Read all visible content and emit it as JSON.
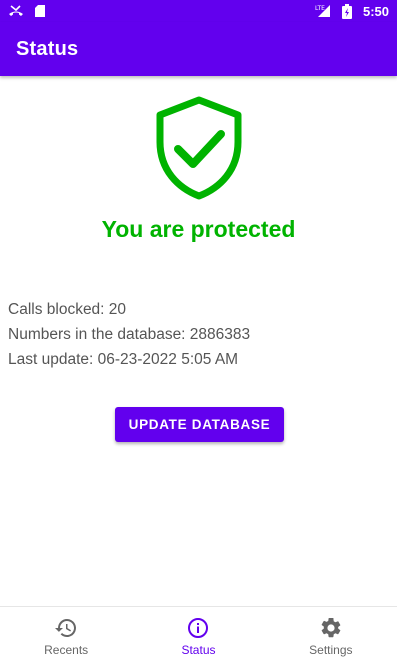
{
  "status_bar": {
    "time": "5:50",
    "network": "LTE",
    "icons": [
      "missed-call-icon",
      "sd-card-icon",
      "signal-icon",
      "battery-charging-icon"
    ]
  },
  "app_bar": {
    "title": "Status"
  },
  "main": {
    "shield_icon": "shield-check-icon",
    "protected_text": "You are protected",
    "protected_color": "#00b300",
    "stats": {
      "calls_blocked": "Calls blocked: 20",
      "numbers_in_db": "Numbers in the database: 2886383",
      "last_update": "Last update: 06-23-2022 5:05 AM"
    },
    "update_button": "UPDATE DATABASE"
  },
  "bottom_nav": {
    "items": [
      {
        "label": "Recents",
        "icon": "history-icon",
        "active": false
      },
      {
        "label": "Status",
        "icon": "info-icon",
        "active": true
      },
      {
        "label": "Settings",
        "icon": "gear-icon",
        "active": false
      }
    ]
  },
  "colors": {
    "primary": "#6200ee",
    "accent_green": "#00b300"
  }
}
